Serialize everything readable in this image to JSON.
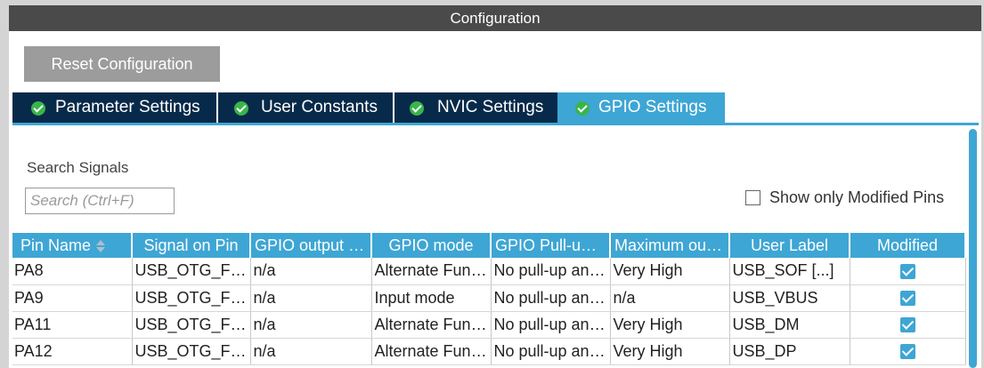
{
  "window": {
    "title": "Configuration"
  },
  "toolbar": {
    "reset_label": "Reset Configuration"
  },
  "tabs": [
    {
      "label": "Parameter Settings",
      "active": false
    },
    {
      "label": "User Constants",
      "active": false
    },
    {
      "label": "NVIC Settings",
      "active": false
    },
    {
      "label": "GPIO Settings",
      "active": true
    }
  ],
  "search": {
    "label": "Search Signals",
    "placeholder": "Search (Ctrl+F)"
  },
  "filter": {
    "show_modified_label": "Show only Modified Pins",
    "checked": false
  },
  "table": {
    "columns": [
      "Pin Name",
      "Signal on Pin",
      "GPIO output level",
      "GPIO mode",
      "GPIO Pull-up/Pull-down",
      "Maximum output speed",
      "User Label",
      "Modified"
    ],
    "rows": [
      {
        "pin": "PA8",
        "signal": "USB_OTG_FS_SOF",
        "output_level": "n/a",
        "mode": "Alternate Function Push Pull",
        "pull": "No pull-up and no pull-down",
        "speed": "Very High",
        "label": "USB_SOF [...]",
        "modified": true
      },
      {
        "pin": "PA9",
        "signal": "USB_OTG_FS_VBUS",
        "output_level": "n/a",
        "mode": "Input mode",
        "pull": "No pull-up and no pull-down",
        "speed": "n/a",
        "label": "USB_VBUS",
        "modified": true
      },
      {
        "pin": "PA11",
        "signal": "USB_OTG_FS_DM",
        "output_level": "n/a",
        "mode": "Alternate Function Push Pull",
        "pull": "No pull-up and no pull-down",
        "speed": "Very High",
        "label": "USB_DM",
        "modified": true
      },
      {
        "pin": "PA12",
        "signal": "USB_OTG_FS_DP",
        "output_level": "n/a",
        "mode": "Alternate Function Push Pull",
        "pull": "No pull-up and no pull-down",
        "speed": "Very High",
        "label": "USB_DP",
        "modified": true
      }
    ]
  },
  "colors": {
    "accent": "#3ea6d4",
    "tab_dark": "#082a4a",
    "title_bar": "#4a4a4a",
    "check_green": "#39b54a",
    "button_gray": "#9c9c9c"
  }
}
